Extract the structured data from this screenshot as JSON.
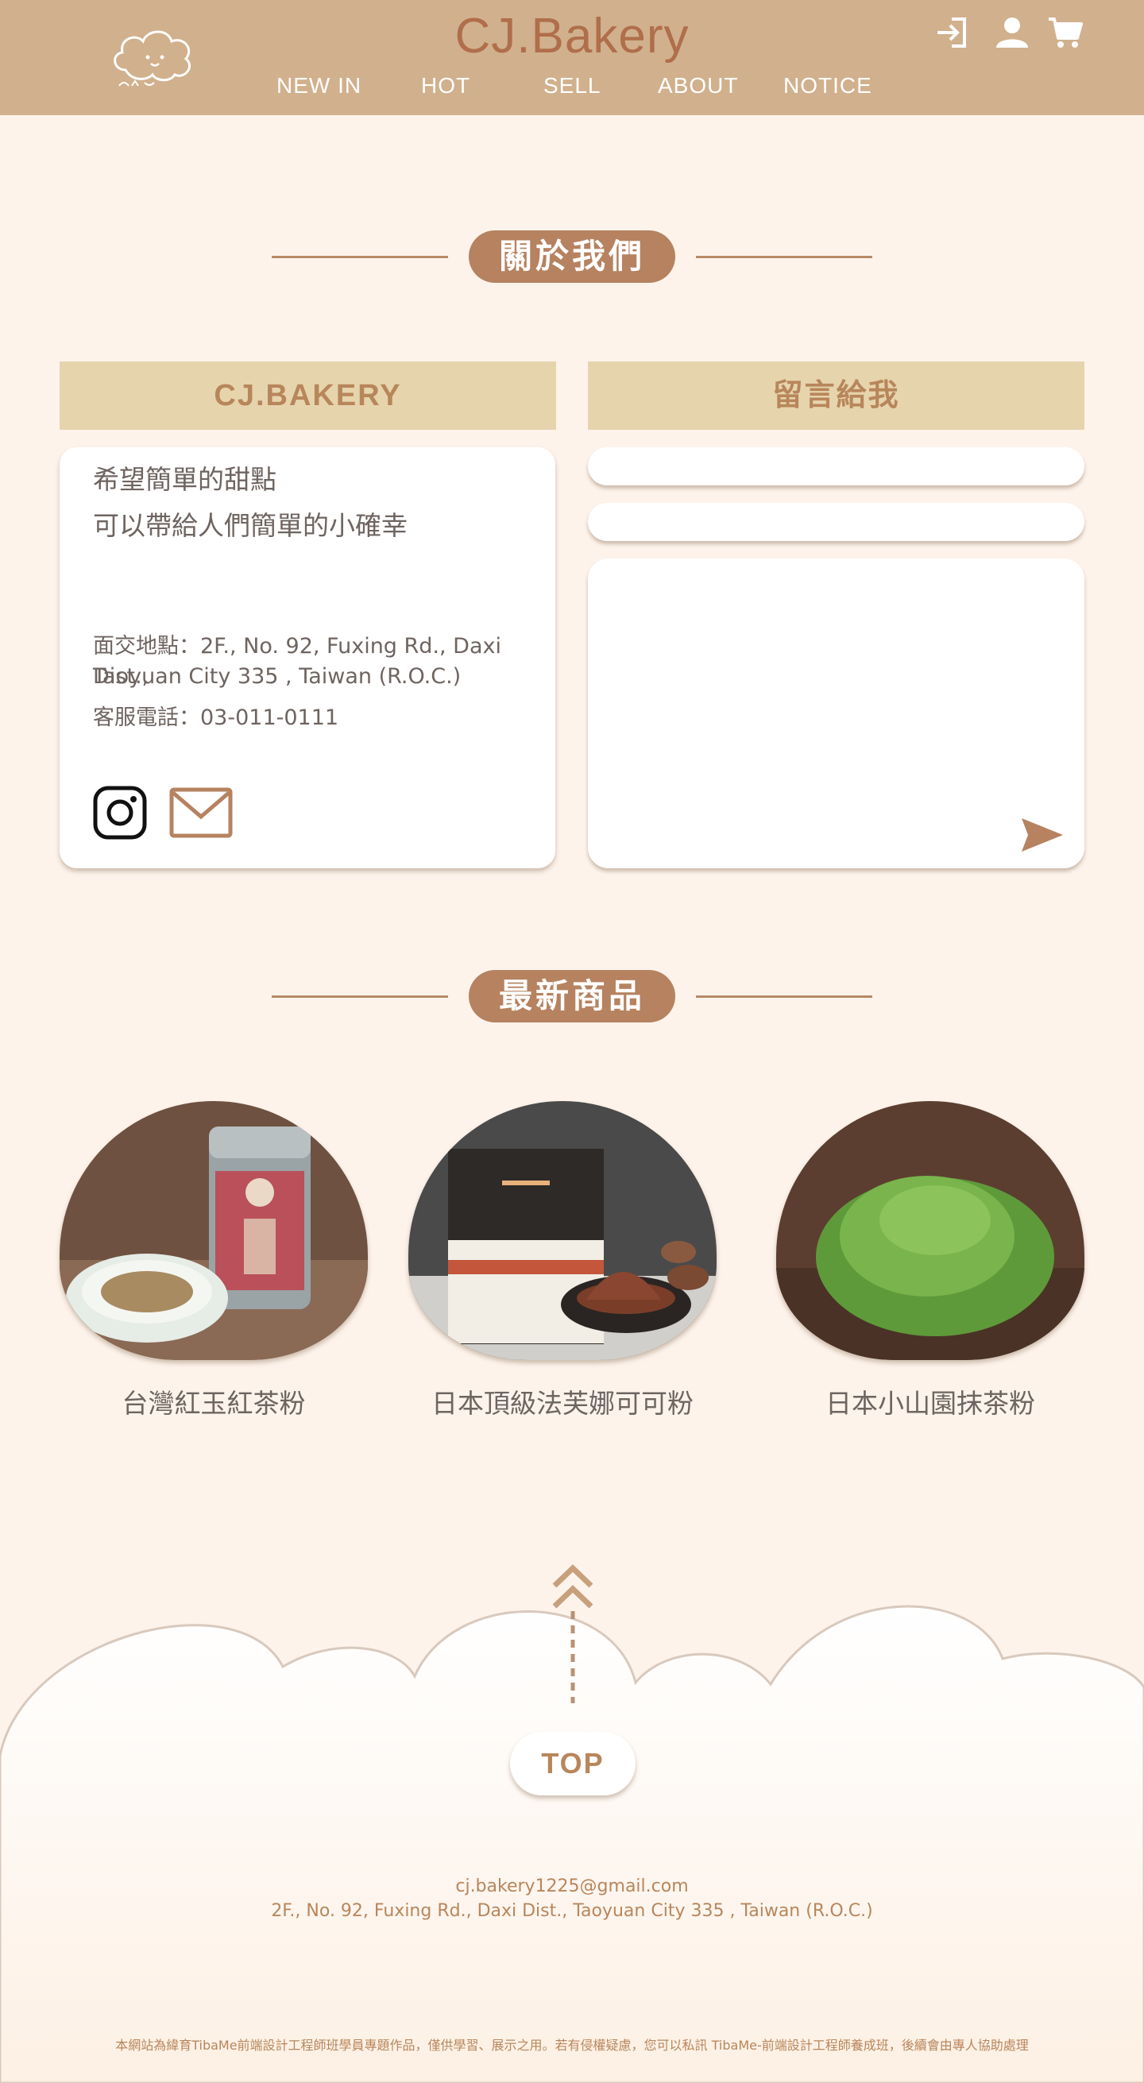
{
  "header": {
    "brand": "CJ.Bakery",
    "nav": [
      "NEW IN",
      "HOT",
      "SELL",
      "ABOUT",
      "NOTICE"
    ],
    "icons": [
      "login-icon",
      "user-icon",
      "cart-icon"
    ]
  },
  "about": {
    "section_title": "關於我們",
    "brand_card_title": "CJ.BAKERY",
    "slogan_line1": "希望簡單的甜點",
    "slogan_line2": "可以帶給人們簡單的小確幸",
    "address_line1": "面交地點：2F., No. 92, Fuxing Rd., Daxi Dist.,",
    "address_line2": "Taoyuan City 335 , Taiwan (R.O.C.)",
    "phone": "客服電話：03-011-0111",
    "message_card_title": "留言給我",
    "name_value": "",
    "email_value": "",
    "message_value": ""
  },
  "products": {
    "section_title": "最新商品",
    "items": [
      {
        "name": "台灣紅玉紅茶粉"
      },
      {
        "name": "日本頂級法芙娜可可粉"
      },
      {
        "name": "日本小山園抹茶粉"
      }
    ]
  },
  "footer": {
    "top_label": "TOP",
    "email": "cj.bakery1225@gmail.com",
    "address": "2F., No. 92, Fuxing Rd., Daxi Dist., Taoyuan City 335 , Taiwan (R.O.C.)",
    "disclaimer": "本網站為緯育TibaMe前端設計工程師班學員專題作品，僅供學習、展示之用。若有侵權疑慮，您可以私訊 TibaMe-前端設計工程師養成班，後續會由專人協助處理"
  },
  "colors": {
    "header_bg": "#d1b08d",
    "page_bg": "#fdf3eb",
    "accent": "#b68260",
    "card_head_bg": "#e6d4ad",
    "card_head_text": "#b8865b"
  }
}
